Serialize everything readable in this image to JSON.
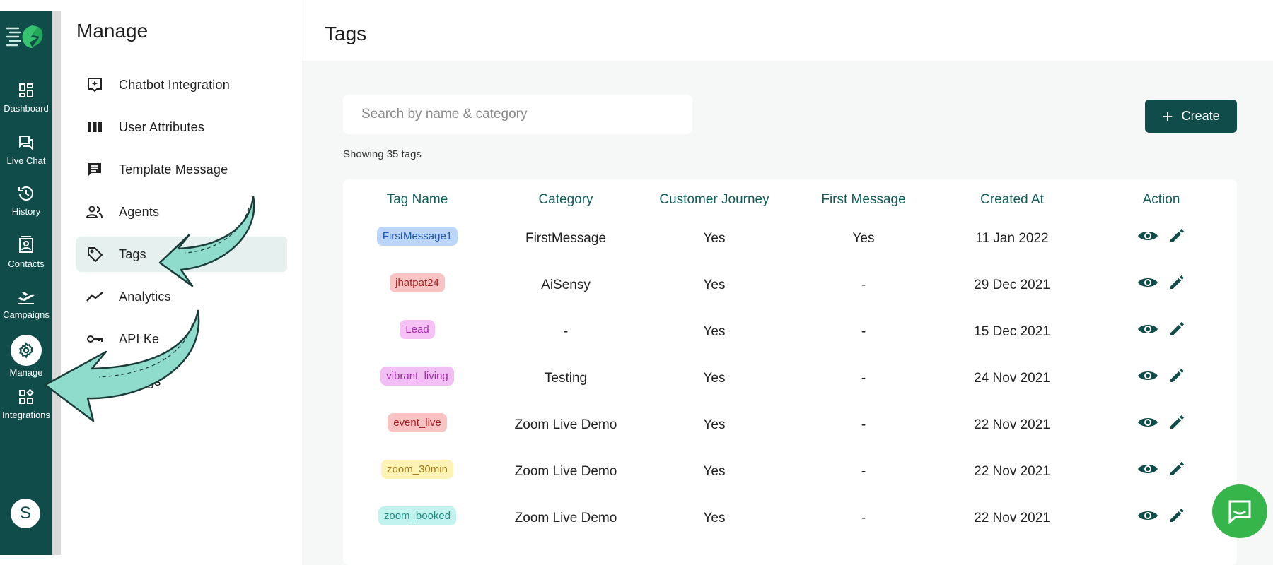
{
  "rail": {
    "items": [
      {
        "label": "Dashboard",
        "icon": "dashboard-icon"
      },
      {
        "label": "Live Chat",
        "icon": "chat-icon"
      },
      {
        "label": "History",
        "icon": "history-icon"
      },
      {
        "label": "Contacts",
        "icon": "contacts-icon"
      },
      {
        "label": "Campaigns",
        "icon": "airplane-icon"
      },
      {
        "label": "Manage",
        "icon": "gear-icon"
      },
      {
        "label": "Integrations",
        "icon": "widgets-icon"
      }
    ],
    "avatar_initial": "S"
  },
  "manage": {
    "title": "Manage",
    "items": [
      {
        "label": "Chatbot Integration",
        "icon": "chatbot-icon"
      },
      {
        "label": "User Attributes",
        "icon": "columns-icon"
      },
      {
        "label": "Template Message",
        "icon": "message-icon"
      },
      {
        "label": "Agents",
        "icon": "people-icon"
      },
      {
        "label": "Tags",
        "icon": "tag-icon"
      },
      {
        "label": "Analytics",
        "icon": "trend-icon"
      },
      {
        "label": "API Ke",
        "icon": "key-icon"
      },
      {
        "label": "gs",
        "icon": "settings-icon"
      }
    ]
  },
  "page": {
    "title": "Tags",
    "search_placeholder": "Search by name & category",
    "create_label": "Create",
    "showing": "Showing 35 tags"
  },
  "table": {
    "headers": [
      "Tag Name",
      "Category",
      "Customer Journey",
      "First Message",
      "Created At",
      "Action"
    ],
    "rows": [
      {
        "tag": "FirstMessage1",
        "tag_bg": "#bcd6fb",
        "tag_fg": "#1e55b0",
        "category": "FirstMessage",
        "journey": "Yes",
        "first": "Yes",
        "created": "11 Jan 2022"
      },
      {
        "tag": "jhatpat24",
        "tag_bg": "#f8c3c3",
        "tag_fg": "#a42020",
        "category": "AiSensy",
        "journey": "Yes",
        "first": "-",
        "created": "29 Dec 2021"
      },
      {
        "tag": "Lead",
        "tag_bg": "#f6c2f6",
        "tag_fg": "#a02aa6",
        "category": "-",
        "journey": "Yes",
        "first": "-",
        "created": "15 Dec 2021"
      },
      {
        "tag": "vibrant_living",
        "tag_bg": "#f2bff5",
        "tag_fg": "#9a2ba3",
        "category": "Testing",
        "journey": "Yes",
        "first": "-",
        "created": "24 Nov 2021"
      },
      {
        "tag": "event_live",
        "tag_bg": "#f8c3c3",
        "tag_fg": "#a42020",
        "category": "Zoom Live Demo",
        "journey": "Yes",
        "first": "-",
        "created": "22 Nov 2021"
      },
      {
        "tag": "zoom_30min",
        "tag_bg": "#fdf3b5",
        "tag_fg": "#a07a14",
        "category": "Zoom Live Demo",
        "journey": "Yes",
        "first": "-",
        "created": "22 Nov 2021"
      },
      {
        "tag": "zoom_booked",
        "tag_bg": "#c3f3ee",
        "tag_fg": "#1d8a80",
        "category": "Zoom Live Demo",
        "journey": "Yes",
        "first": "-",
        "created": "22 Nov 2021"
      }
    ]
  },
  "colors": {
    "brand": "#0f4c4a",
    "header_text": "#0f5c58",
    "chat": "#36b54a",
    "arrow": "#8fdccc"
  }
}
